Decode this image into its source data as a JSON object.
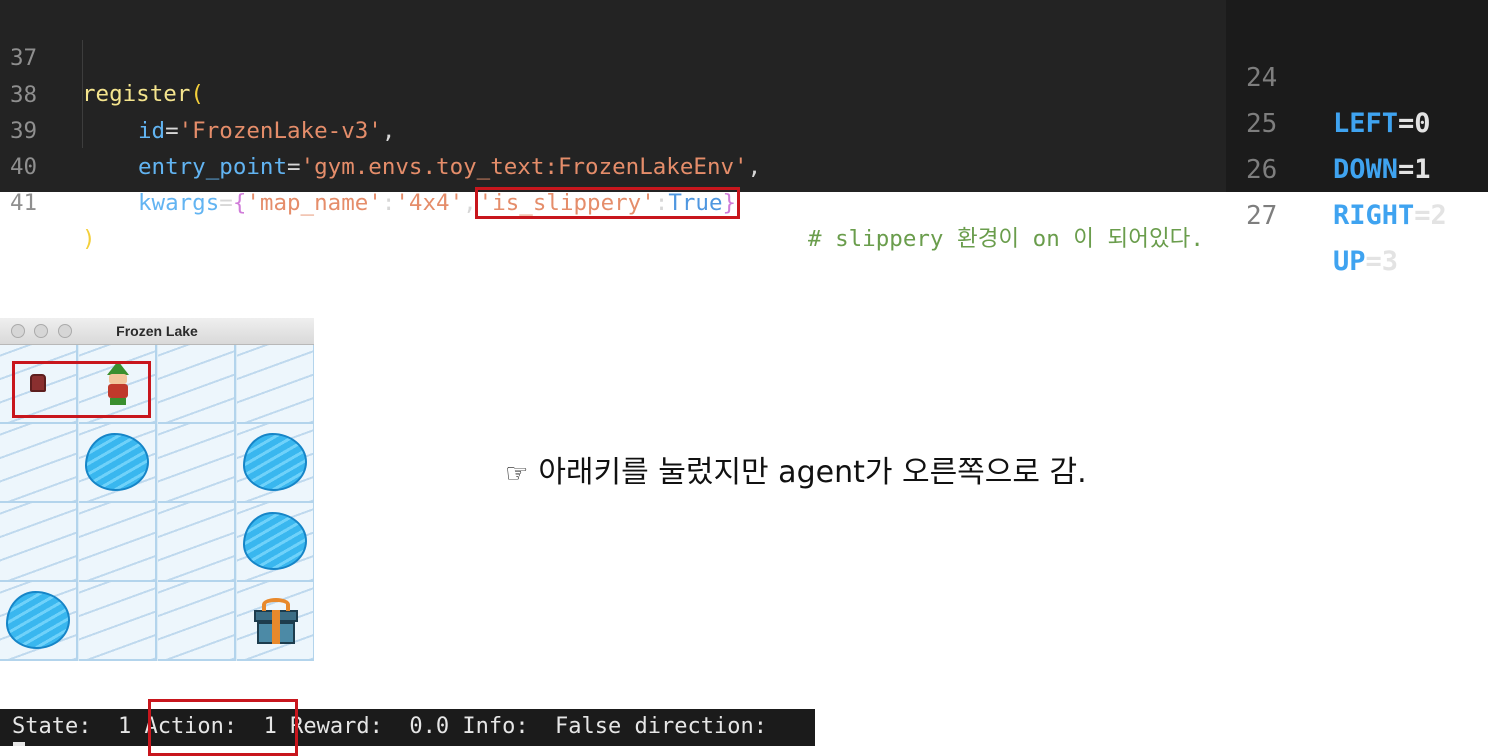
{
  "code": {
    "lines": [
      {
        "num": "37",
        "fn": "register",
        "open": "("
      },
      {
        "num": "38",
        "key": "id",
        "eq": "=",
        "str": "'FrozenLake-v3'",
        "tail": ","
      },
      {
        "num": "39",
        "key": "entry_point",
        "eq": "=",
        "str": "'gym.envs.toy_text:FrozenLakeEnv'",
        "tail": ","
      },
      {
        "num": "40",
        "key": "kwargs",
        "eq": "=",
        "brace_open": "{",
        "k1": "'map_name'",
        "colon1": ":",
        "v1": "'4x4'",
        "comma": ",",
        "k2": "'is_slippery'",
        "colon2": ":",
        "v2": "True",
        "brace_close": "}",
        "comment": "# slippery 환경이 on 이 되어있다."
      },
      {
        "num": "41",
        "close": ")"
      }
    ]
  },
  "actions": [
    {
      "num": "24",
      "name": "LEFT",
      "value": "=0"
    },
    {
      "num": "25",
      "name": "DOWN",
      "value": "=1"
    },
    {
      "num": "26",
      "name": "RIGHT",
      "value": "=2"
    },
    {
      "num": "27",
      "name": "UP",
      "value": "=3"
    }
  ],
  "window": {
    "title": "Frozen Lake",
    "map": [
      [
        "start",
        "agent",
        "frozen",
        "frozen"
      ],
      [
        "frozen",
        "hole",
        "frozen",
        "hole"
      ],
      [
        "frozen",
        "frozen",
        "frozen",
        "hole"
      ],
      [
        "hole",
        "frozen",
        "frozen",
        "goal"
      ]
    ]
  },
  "note": {
    "icon": "☞",
    "text": "아래키를 눌렀지만 agent가 오른쪽으로 감."
  },
  "terminal": {
    "line": "State:  1 Action:  1 Reward:  0.0 Info:  False direction:"
  },
  "colors": {
    "highlight": "#c8161d",
    "editor_bg": "#232323",
    "terminal_bg": "#1b1b1b"
  }
}
